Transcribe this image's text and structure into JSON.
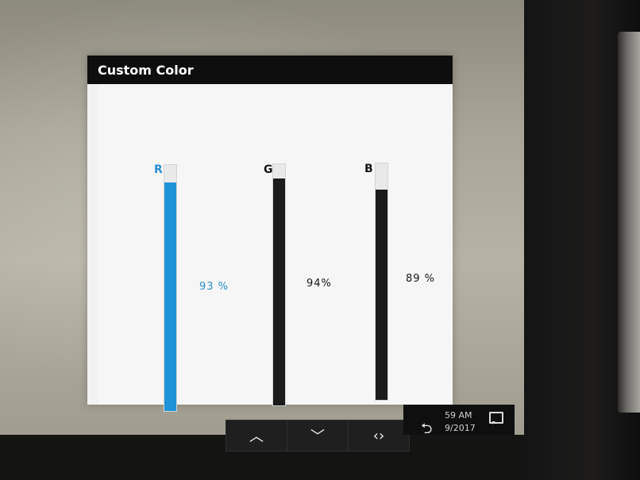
{
  "window": {
    "title": "Custom Color"
  },
  "channels": [
    {
      "label": "R",
      "percent_text": "93 %",
      "level": 0.93,
      "color": "#1f93d8",
      "label_color": "#2a8fcf"
    },
    {
      "label": "G",
      "percent_text": "94%",
      "level": 0.94,
      "color": "#1c1c1c",
      "label_color": "#151515"
    },
    {
      "label": "B",
      "percent_text": "89 %",
      "level": 0.89,
      "color": "#1c1c1c",
      "label_color": "#151515"
    }
  ],
  "osd_buttons": [
    {
      "name": "up-button",
      "icon": "chevron-up-icon",
      "glyph": "︿"
    },
    {
      "name": "down-button",
      "icon": "chevron-down-icon",
      "glyph": "﹀"
    },
    {
      "name": "input-button",
      "icon": "arrows-left-right-icon",
      "glyph": "‹›"
    }
  ],
  "taskbar": {
    "time": "59 AM",
    "date": "9/2017",
    "back_icon": "back-arrow-icon",
    "notification_icon": "notification-icon"
  }
}
